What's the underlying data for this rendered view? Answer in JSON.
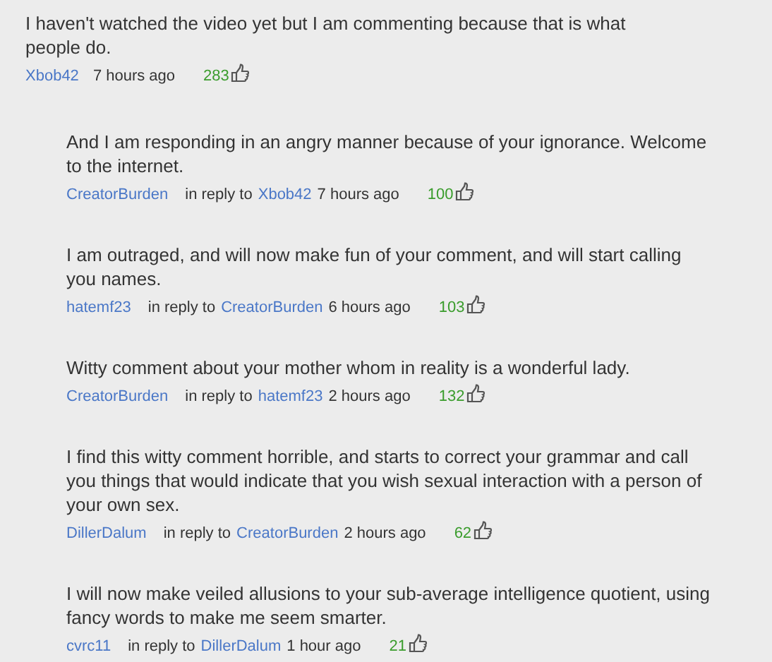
{
  "comment": {
    "text": "I haven't watched the video yet but I am commenting because that is what people do.",
    "author": "Xbob42",
    "time": "7 hours ago",
    "likes": "283",
    "replies": [
      {
        "text": "And I am responding in an angry manner because of your ignorance. Welcome to the internet.",
        "author": "CreatorBurden",
        "reply_label": "in reply to",
        "reply_to": "Xbob42",
        "time": "7 hours ago",
        "likes": "100"
      },
      {
        "text": "I am outraged, and will now make fun of your comment, and will start calling you names.",
        "author": "hatemf23",
        "reply_label": "in reply to",
        "reply_to": "CreatorBurden",
        "time": "6 hours ago",
        "likes": "103"
      },
      {
        "text": "Witty comment about your mother whom in reality is a wonderful lady.",
        "author": "CreatorBurden",
        "reply_label": "in reply to",
        "reply_to": "hatemf23",
        "time": "2 hours ago",
        "likes": "132"
      },
      {
        "text": "I find this witty comment horrible, and starts to correct your grammar and call you things that would indicate that you wish sexual interaction with a person of your own sex.",
        "author": "DillerDalum",
        "reply_label": "in reply to",
        "reply_to": "CreatorBurden",
        "time": "2 hours ago",
        "likes": "62"
      },
      {
        "text": "I will now make veiled allusions to your sub-average intelligence quotient, using fancy words to make me seem smarter.",
        "author": "cvrc11",
        "reply_label": "in reply to",
        "reply_to": "DillerDalum",
        "time": "1 hour ago",
        "likes": "21"
      }
    ]
  }
}
